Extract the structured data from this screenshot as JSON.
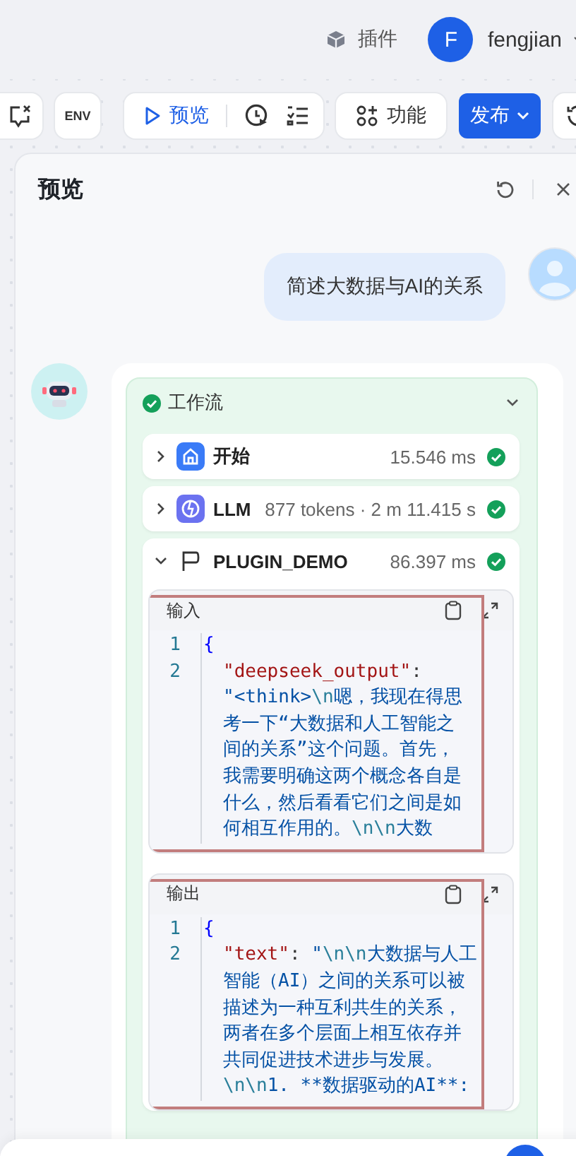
{
  "header": {
    "plugin_label": "插件",
    "user": {
      "initial": "F",
      "name": "fengjian"
    }
  },
  "toolbar": {
    "env_label": "ENV",
    "preview_label": "预览",
    "features_label": "功能",
    "publish_label": "发布"
  },
  "panel": {
    "title": "预览"
  },
  "user_message": "简述大数据与AI的关系",
  "workflow": {
    "title": "工作流",
    "succeeded": true,
    "expanded": true,
    "nodes": [
      {
        "kind": "start",
        "name": "开始",
        "meta": "15.546 ms",
        "succeeded": true,
        "expanded": false
      },
      {
        "kind": "llm",
        "name": "LLM",
        "meta": "877 tokens · 2 m 11.415 s",
        "succeeded": true,
        "expanded": false
      },
      {
        "kind": "plugin",
        "name": "PLUGIN_DEMO",
        "meta": "86.397 ms",
        "succeeded": true,
        "expanded": true,
        "blocks": [
          {
            "title": "输入",
            "lines": [
              {
                "number": "1",
                "rows": [
                  {
                    "tokens": [
                      {
                        "kind": "punct",
                        "text": "{"
                      }
                    ]
                  }
                ]
              },
              {
                "number": "2",
                "rows": [
                  {
                    "tokens": [
                      {
                        "kind": "key",
                        "text": "\"deepseek_output\""
                      },
                      {
                        "kind": "punct",
                        "text": ":"
                      }
                    ]
                  },
                  {
                    "tokens": [
                      {
                        "kind": "str",
                        "text": "\"<think>"
                      },
                      {
                        "kind": "esc",
                        "text": "\\n"
                      },
                      {
                        "kind": "str",
                        "text": "嗯，我现在得思"
                      }
                    ]
                  },
                  {
                    "tokens": [
                      {
                        "kind": "str",
                        "text": "考一下“大数据和人工智能之"
                      }
                    ]
                  },
                  {
                    "tokens": [
                      {
                        "kind": "str",
                        "text": "间的关系”这个问题。首先，"
                      }
                    ]
                  },
                  {
                    "tokens": [
                      {
                        "kind": "str",
                        "text": "我需要明确这两个概念各自是"
                      }
                    ]
                  },
                  {
                    "tokens": [
                      {
                        "kind": "str",
                        "text": "什么，然后看看它们之间是如"
                      }
                    ]
                  },
                  {
                    "tokens": [
                      {
                        "kind": "str",
                        "text": "何相互作用的。"
                      },
                      {
                        "kind": "esc",
                        "text": "\\n\\n"
                      },
                      {
                        "kind": "str",
                        "text": "大数"
                      }
                    ]
                  }
                ]
              }
            ]
          },
          {
            "title": "输出",
            "lines": [
              {
                "number": "1",
                "rows": [
                  {
                    "tokens": [
                      {
                        "kind": "punct",
                        "text": "{"
                      }
                    ]
                  }
                ]
              },
              {
                "number": "2",
                "rows": [
                  {
                    "tokens": [
                      {
                        "kind": "key",
                        "text": "\"text\""
                      },
                      {
                        "kind": "punct",
                        "text": ": "
                      },
                      {
                        "kind": "str",
                        "text": "\""
                      },
                      {
                        "kind": "esc",
                        "text": "\\n\\n"
                      },
                      {
                        "kind": "str",
                        "text": "大数据与人工"
                      }
                    ]
                  },
                  {
                    "tokens": [
                      {
                        "kind": "str",
                        "text": "智能（AI）之间的关系可以被"
                      }
                    ]
                  },
                  {
                    "tokens": [
                      {
                        "kind": "str",
                        "text": "描述为一种互利共生的关系，"
                      }
                    ]
                  },
                  {
                    "tokens": [
                      {
                        "kind": "str",
                        "text": "两者在多个层面上相互依存并"
                      }
                    ]
                  },
                  {
                    "tokens": [
                      {
                        "kind": "str",
                        "text": "共同促进技术进步与发展。"
                      }
                    ]
                  },
                  {
                    "tokens": [
                      {
                        "kind": "esc",
                        "text": "\\n\\n"
                      },
                      {
                        "kind": "str",
                        "text": "1. **数据驱动的AI**:"
                      }
                    ]
                  }
                ]
              }
            ]
          }
        ]
      }
    ]
  }
}
